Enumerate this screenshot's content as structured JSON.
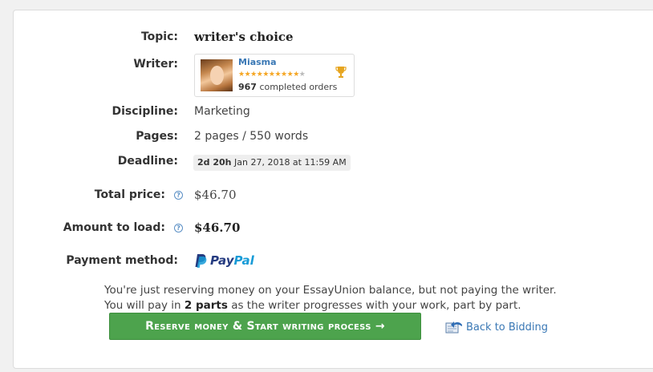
{
  "order": {
    "topic": {
      "label": "Topic:",
      "value": "writer's choice"
    },
    "writer": {
      "label": "Writer:",
      "name": "Miasma",
      "stars_filled": 10,
      "stars_total": 11,
      "orders_count": "967",
      "orders_suffix": "completed orders"
    },
    "discipline": {
      "label": "Discipline:",
      "value": "Marketing"
    },
    "pages": {
      "label": "Pages:",
      "value": "2 pages / 550 words"
    },
    "deadline": {
      "label": "Deadline:",
      "remaining": "2d 20h",
      "date": "Jan 27, 2018 at 11:59 AM"
    },
    "total_price": {
      "label": "Total price:",
      "value": "$46.70",
      "help": "?"
    },
    "amount_to_load": {
      "label": "Amount to load:",
      "value": "$46.70",
      "help": "?"
    },
    "payment_method": {
      "label": "Payment method:",
      "paypal_pay": "Pay",
      "paypal_pal": "Pal"
    }
  },
  "notes": {
    "line1": "You're just reserving money on your EssayUnion balance, but not paying the writer.",
    "line2_prefix": "You will pay in",
    "line2_bold": "2 parts",
    "line2_suffix": "as the writer progresses with your work, part by part."
  },
  "actions": {
    "reserve_label": "Reserve money & Start writing  process →",
    "back_label": "Back to Bidding"
  },
  "colors": {
    "button_green": "#4da34d",
    "link_blue": "#3a78b5",
    "star_orange": "#f5a623",
    "paypal_dark": "#253b80",
    "paypal_light": "#179bd7"
  }
}
